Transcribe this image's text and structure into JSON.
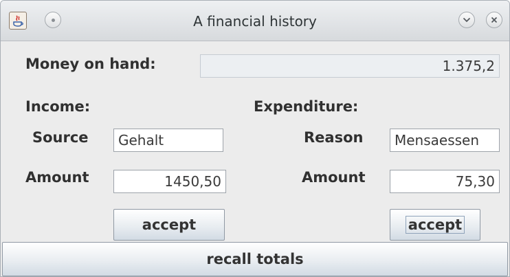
{
  "window": {
    "title": "A financial history"
  },
  "money": {
    "label": "Money on hand:",
    "value": "1.375,2"
  },
  "income": {
    "heading": "Income:",
    "source_label": "Source",
    "source_value": "Gehalt",
    "amount_label": "Amount",
    "amount_value": "1450,50",
    "accept_label": "accept"
  },
  "expenditure": {
    "heading": "Expenditure:",
    "reason_label": "Reason",
    "reason_value": "Mensaessen",
    "amount_label": "Amount",
    "amount_value": "75,30",
    "accept_label": "accept"
  },
  "recall": {
    "label": "recall totals"
  },
  "icons": {
    "app": "java-app-icon",
    "menu": "window-menu-icon",
    "minimize": "chevron-down-icon",
    "close": "close-icon"
  }
}
